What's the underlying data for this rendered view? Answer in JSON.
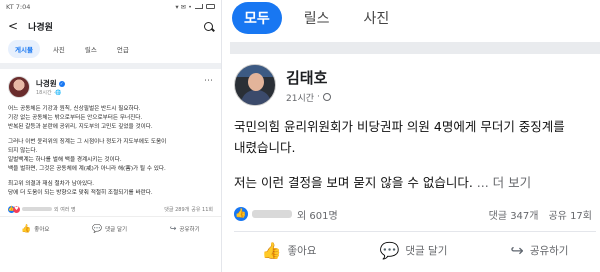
{
  "left": {
    "status": {
      "carrier_time": "KT 7:04",
      "right_icons": "▾ ✉ •"
    },
    "header": {
      "back": "<",
      "name": "나경원"
    },
    "tabs": [
      {
        "label": "게시물"
      },
      {
        "label": "사진"
      },
      {
        "label": "릴스"
      },
      {
        "label": "언급"
      }
    ],
    "post": {
      "author": "나경원",
      "time": "18시간",
      "paragraphs": [
        "어느 공동체든 기강과 원칙, 신상필벌은 반드시 필요하다.\n기강 없는 공동체는 밖으로부터든 안으로부터든 무너진다.\n반복된 갈등과 분란에 공위리, 지도부의 고민도 깊었을 것이다.",
        "그러나 이번 윤리위의 징계는 그 시점이나 정도가 지도부에도 도움이\n되지 않는다.\n일벌백계는 하나를 벌해 백을 경계시키는 것이다.\n백을 벌하면, 그것은 공동체에 계(戒)가 아니라 해(害)가 될 수 있다.",
        "최고위 의결과 재심 절차가 남아있다.\n당에 더 도움이 되는 방향으로 맞춰 적절히 조절되기를 바란다."
      ],
      "reactions_text": "외 여러 명",
      "comments": "댓글 289개",
      "shares": "공유 11회",
      "actions": [
        {
          "label": "좋아요",
          "icon": "👍"
        },
        {
          "label": "댓글 달기",
          "icon": "💬"
        },
        {
          "label": "공유하기",
          "icon": "↪"
        }
      ]
    }
  },
  "right": {
    "tabs": [
      {
        "label": "모두"
      },
      {
        "label": "릴스"
      },
      {
        "label": "사진"
      }
    ],
    "post": {
      "author": "김태호",
      "time": "21시간",
      "line1": "국민의힘 윤리위원회가 비당권파 의원 4명에게 무더기 중징계를",
      "line2": "내렸습니다.",
      "line3": "저는 이런 결정을 보며 묻지 않을 수 없습니다.",
      "more_link": "... 더 보기",
      "reactions_text": "외 601명",
      "comments": "댓글 347개",
      "shares": "공유 17회",
      "actions": [
        {
          "label": "좋아요",
          "icon": "👍"
        },
        {
          "label": "댓글 달기",
          "icon": "💬"
        },
        {
          "label": "공유하기",
          "icon": "↪"
        }
      ]
    }
  },
  "colors": {
    "facebook_blue": "#1877f2",
    "love_red": "#f33e58",
    "text_gray": "#65676b"
  }
}
